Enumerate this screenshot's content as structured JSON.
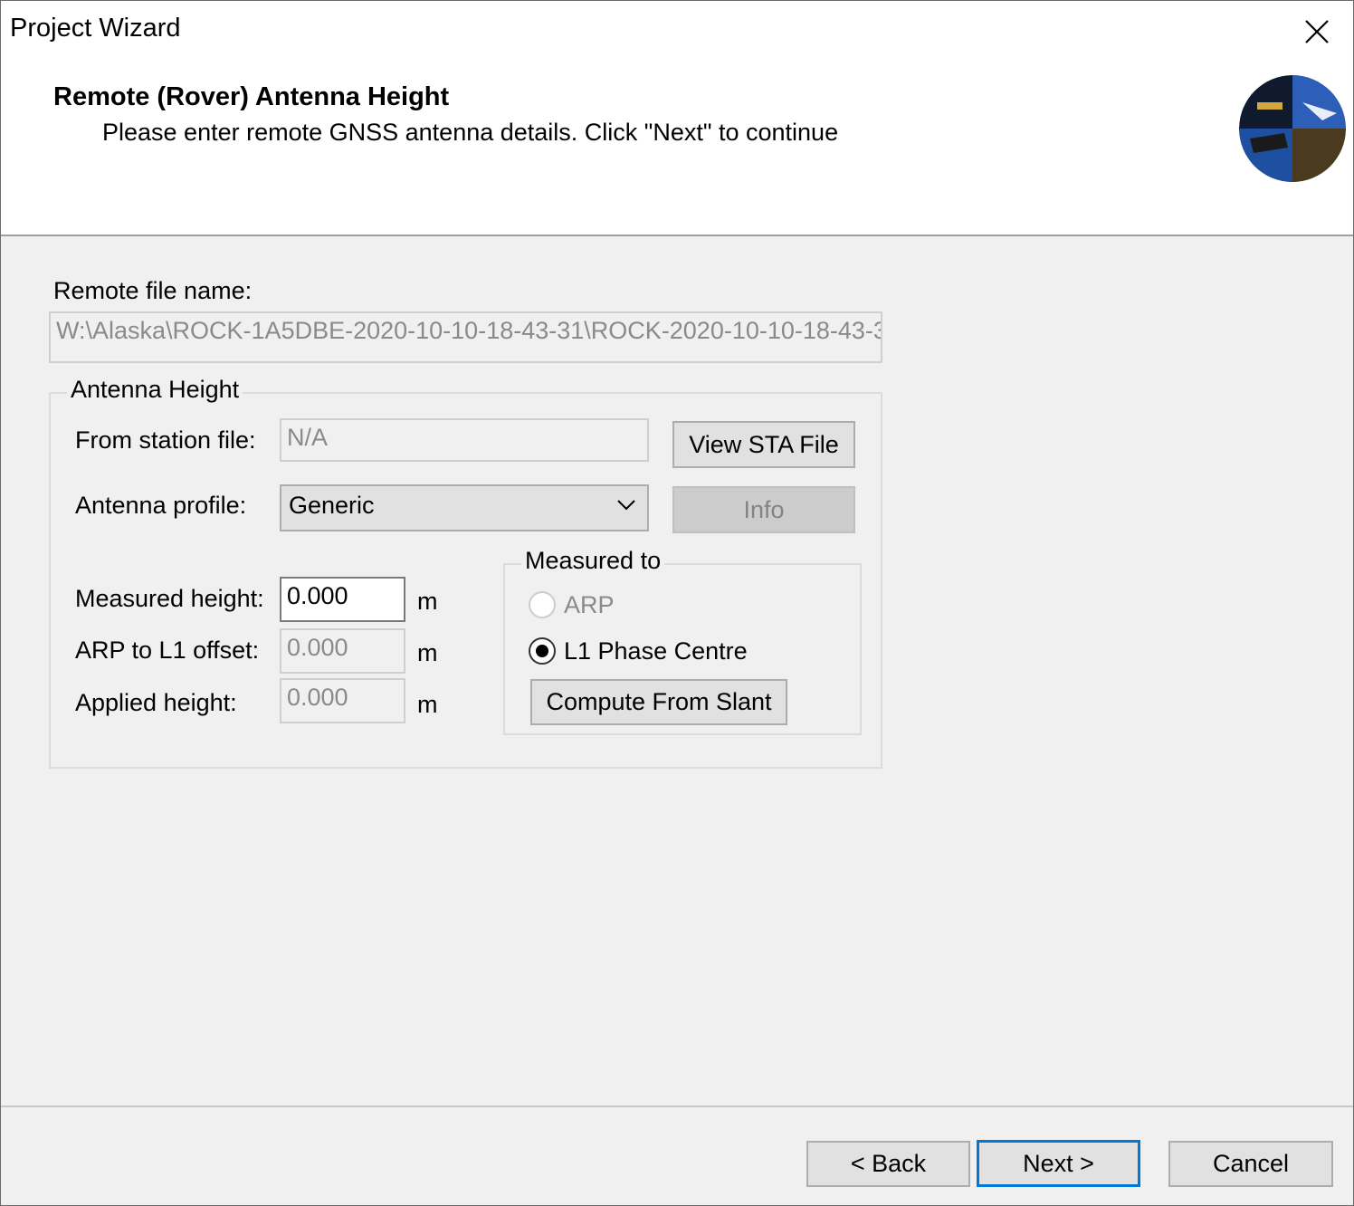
{
  "window": {
    "title": "Project Wizard"
  },
  "header": {
    "title": "Remote (Rover) Antenna Height",
    "subtitle": "Please enter remote GNSS antenna details. Click \"Next\" to continue"
  },
  "remote_file": {
    "label": "Remote file name:",
    "value": "W:\\Alaska\\ROCK-1A5DBE-2020-10-10-18-43-31\\ROCK-2020-10-10-18-43-3"
  },
  "antenna_height": {
    "group_label": "Antenna Height",
    "station_file_label": "From station file:",
    "station_file_value": "N/A",
    "view_sta_button": "View STA File",
    "profile_label": "Antenna profile:",
    "profile_value": "Generic",
    "info_button": "Info",
    "measured_height_label": "Measured height:",
    "measured_height_value": "0.000",
    "arp_offset_label": "ARP to L1 offset:",
    "arp_offset_value": "0.000",
    "applied_height_label": "Applied height:",
    "applied_height_value": "0.000",
    "unit": "m"
  },
  "measured_to": {
    "group_label": "Measured to",
    "option_arp": "ARP",
    "option_l1": "L1 Phase Centre",
    "selected": "L1 Phase Centre",
    "compute_button": "Compute From Slant"
  },
  "footer": {
    "back": "< Back",
    "next": "Next >",
    "cancel": "Cancel"
  },
  "icons": {
    "close": "close-icon",
    "chevron": "chevron-down-icon",
    "logo": "app-logo"
  }
}
